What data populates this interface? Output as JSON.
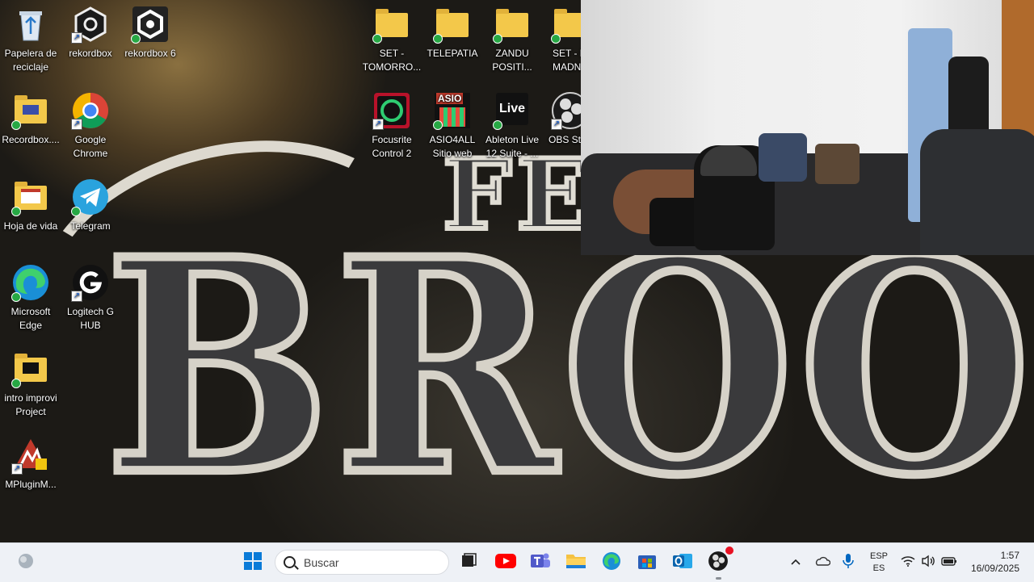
{
  "desktop": {
    "wallpaper_text_top": "FE",
    "wallpaper_text_main": "BROOS",
    "icons": [
      {
        "label": "Papelera de reciclaje",
        "icon": "recycle-bin-icon"
      },
      {
        "label": "rekordbox",
        "icon": "rekordbox-icon"
      },
      {
        "label": "rekordbox 6",
        "icon": "rekordbox6-icon"
      },
      {
        "label": "Recordbox....",
        "icon": "folder-icon"
      },
      {
        "label": "Google Chrome",
        "icon": "chrome-icon"
      },
      {
        "label": "Hoja de vida",
        "icon": "folder-icon"
      },
      {
        "label": "Telegram",
        "icon": "telegram-icon"
      },
      {
        "label": "Microsoft Edge",
        "icon": "edge-icon"
      },
      {
        "label": "Logitech G HUB",
        "icon": "logitech-ghub-icon"
      },
      {
        "label": "intro improvi Project",
        "icon": "folder-icon"
      },
      {
        "label": "MPluginM...",
        "icon": "mplugin-icon"
      },
      {
        "label": "SET - TOMORRO...",
        "icon": "folder-icon"
      },
      {
        "label": "TELEPATIA",
        "icon": "folder-icon"
      },
      {
        "label": "ZANDU POSITI...",
        "icon": "folder-icon"
      },
      {
        "label": "SET - M MADN",
        "icon": "folder-icon"
      },
      {
        "label": "Focusrite Control 2",
        "icon": "focusrite-icon"
      },
      {
        "label": "ASIO4ALL Sitio web",
        "icon": "asio4all-icon"
      },
      {
        "label": "Ableton Live 12 Suite - ...",
        "icon": "ableton-live-icon"
      },
      {
        "label": "OBS Stu",
        "icon": "obs-icon"
      }
    ],
    "asio_badge": "ASIO",
    "live_badge": "Live"
  },
  "taskbar": {
    "search_placeholder": "Buscar",
    "language_top": "ESP",
    "language_bottom": "ES",
    "time": "1:57",
    "date": "16/09/2025",
    "apps": [
      "widgets-icon",
      "start-icon",
      "task-view-icon",
      "youtube-icon",
      "teams-icon",
      "file-explorer-icon",
      "edge-icon",
      "store-icon",
      "outlook-icon",
      "obs-icon"
    ],
    "accent": "#0067c0"
  }
}
